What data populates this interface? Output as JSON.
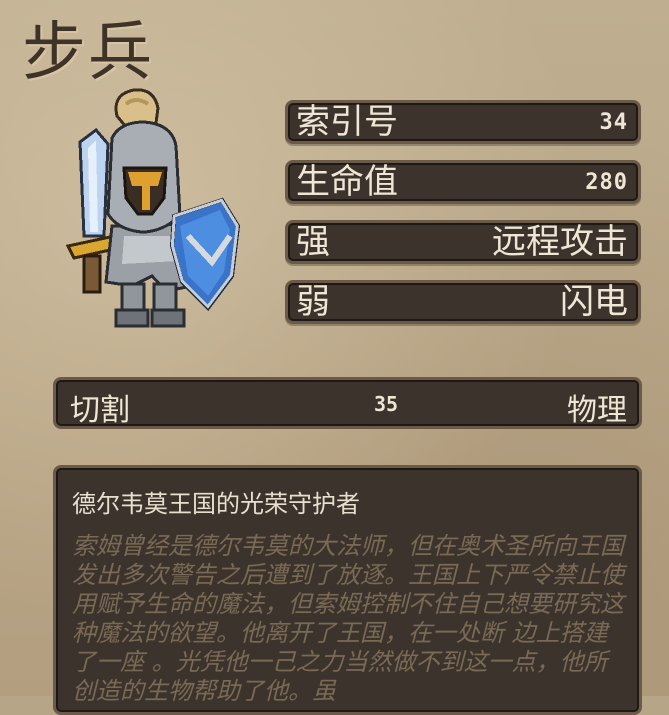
{
  "unit": {
    "name": "步兵",
    "sprite_icon": "knight-with-sword-and-shield-icon"
  },
  "stats": [
    {
      "label": "索引号",
      "value": "34"
    },
    {
      "label": "生命值",
      "value": "280"
    },
    {
      "label": "强",
      "value": "远程攻击"
    },
    {
      "label": "弱",
      "value": "闪电"
    }
  ],
  "damage": {
    "type": "切割",
    "value": "35",
    "category": "物理"
  },
  "description": {
    "subtitle": "德尔韦莫王国的光荣守护者",
    "lore": "索姆曾经是德尔韦莫的大法师，但在奥术圣所向王国发出多次警告之后遭到了放逐。王国上下严令禁止使用赋予生命的魔法，但索姆控制不住自己想要研究这种魔法的欲望。他离开了王国，在一处断 边上搭建了一座 。光凭他一己之力当然做不到这一点，他所创造的生物帮助了他。虽"
  },
  "colors": {
    "parchment": "#b7a588",
    "panel": "#3b332c",
    "panel_border": "#6b5a48",
    "panel_text": "#efe6d6",
    "lore_text": "#7a6a55",
    "title_text": "#3f3328"
  }
}
